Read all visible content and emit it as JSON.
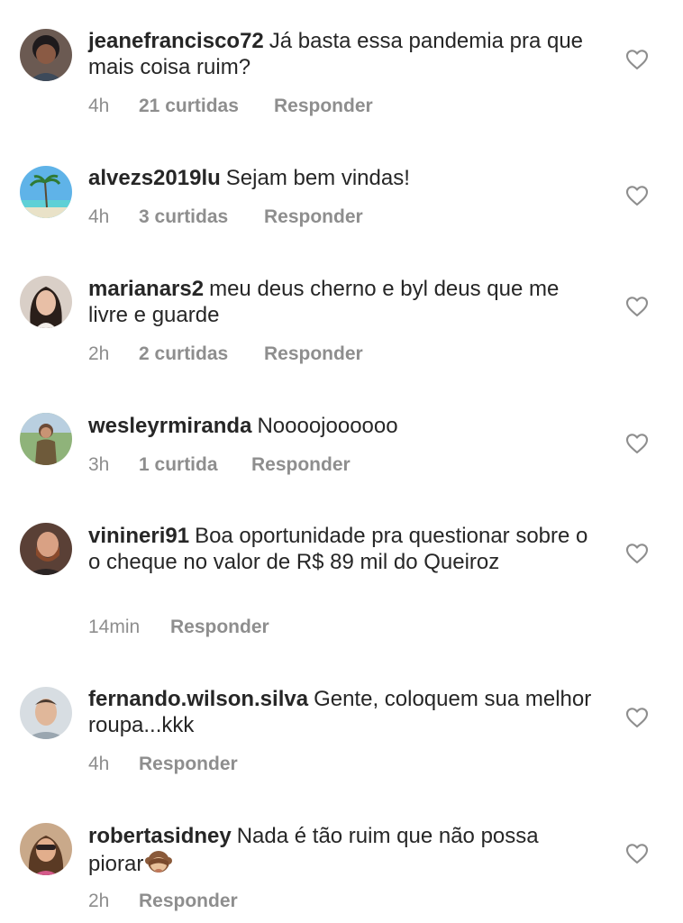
{
  "comments": [
    {
      "username": "jeanefrancisco72",
      "text": "Já basta essa pandemia pra que mais coisa ruim?",
      "time": "4h",
      "likes": "21 curtidas",
      "reply": "Responder"
    },
    {
      "username": "alvezs2019lu",
      "text": "Sejam bem vindas!",
      "time": "4h",
      "likes": "3 curtidas",
      "reply": "Responder"
    },
    {
      "username": "marianars2",
      "text": "meu deus cherno e byl deus que me livre e guarde",
      "time": "2h",
      "likes": "2 curtidas",
      "reply": "Responder"
    },
    {
      "username": "wesleyrmiranda",
      "text": "Noooojoooooo",
      "time": "3h",
      "likes": "1 curtida",
      "reply": "Responder"
    },
    {
      "username": "vinineri91",
      "text": "Boa oportunidade pra questionar sobre o o cheque no valor de R$ 89 mil do Queiroz",
      "time": "14min",
      "likes": "",
      "reply": "Responder"
    },
    {
      "username": "fernando.wilson.silva",
      "text": "Gente, coloquem sua melhor roupa...kkk",
      "time": "4h",
      "likes": "",
      "reply": "Responder"
    },
    {
      "username": "robertasidney",
      "text": "Nada é tão ruim que não possa piorar",
      "time": "2h",
      "likes": "",
      "reply": "Responder"
    }
  ],
  "icons": {
    "like": "heart-outline-icon",
    "emoji": "see-no-evil-monkey-emoji"
  },
  "colors": {
    "text": "#262626",
    "meta": "#8e8e8e"
  }
}
